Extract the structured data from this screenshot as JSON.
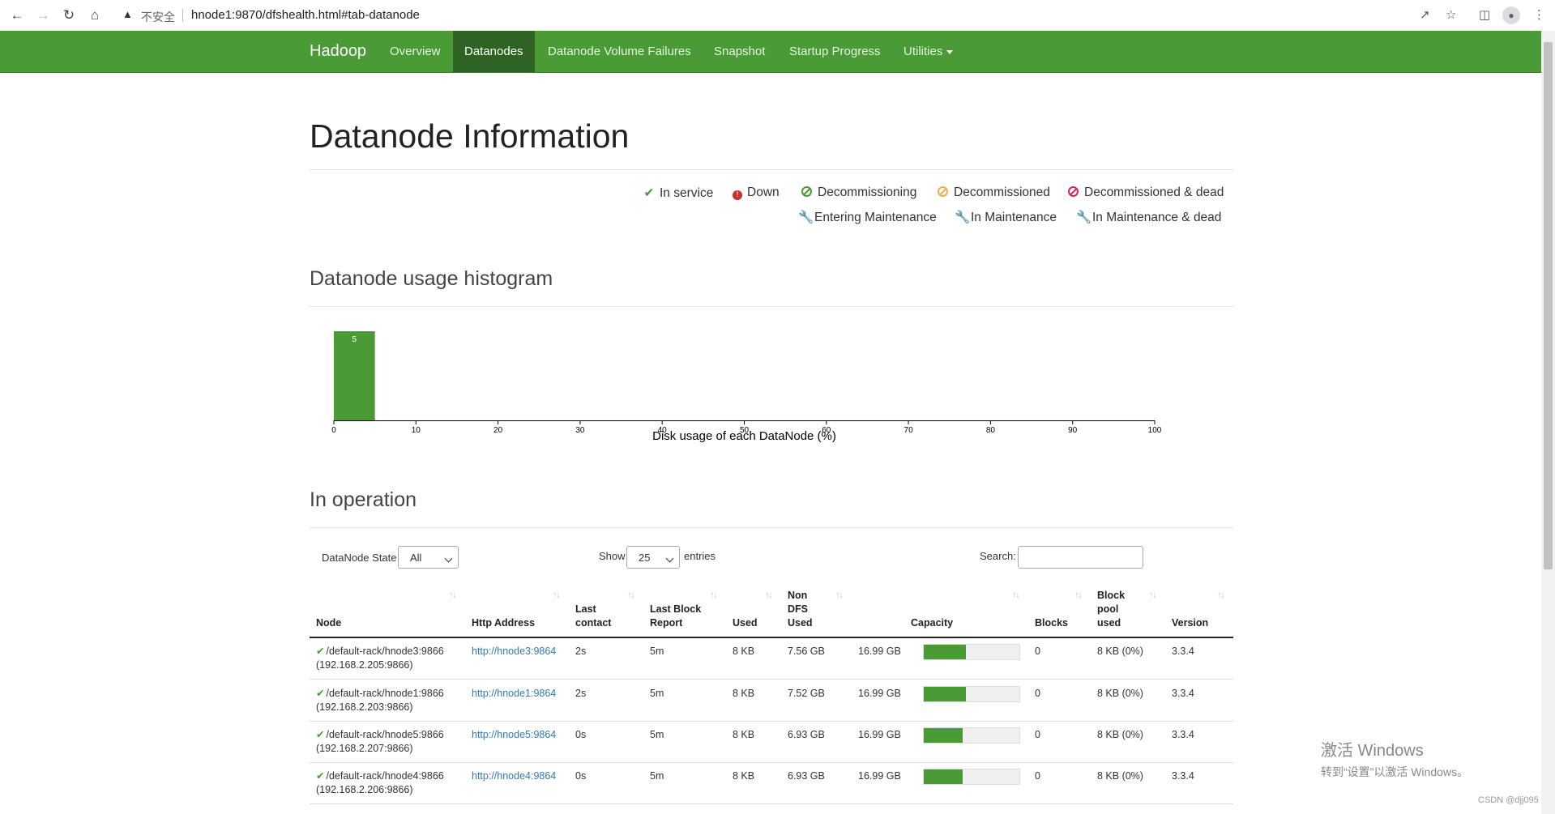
{
  "browser": {
    "security_label": "不安全",
    "url": "hnode1:9870/dfshealth.html#tab-datanode"
  },
  "navbar": {
    "brand": "Hadoop",
    "items": [
      "Overview",
      "Datanodes",
      "Datanode Volume Failures",
      "Snapshot",
      "Startup Progress",
      "Utilities"
    ],
    "active": "Datanodes"
  },
  "page": {
    "title": "Datanode Information",
    "legend": {
      "in_service": "In service",
      "down": "Down",
      "decommissioning": "Decommissioning",
      "decommissioned": "Decommissioned",
      "decommissioned_dead": "Decommissioned & dead",
      "entering_maintenance": "Entering Maintenance",
      "in_maintenance": "In Maintenance",
      "in_maintenance_dead": "In Maintenance & dead"
    },
    "colors": {
      "green": "#4a9a35",
      "red": "#c9302c",
      "orange": "#f0ad4e",
      "magenta": "#d9235a"
    }
  },
  "histogram": {
    "heading": "Datanode usage histogram",
    "chart_data": {
      "type": "bar",
      "xlabel": "Disk usage of each DataNode (%)",
      "xlim": [
        0,
        100
      ],
      "xticks": [
        "0",
        "10",
        "20",
        "30",
        "40",
        "50",
        "60",
        "70",
        "80",
        "90",
        "100"
      ],
      "bins": [
        {
          "x0": 0,
          "x1": 5,
          "count": 5,
          "label": "5"
        }
      ]
    }
  },
  "operation": {
    "heading": "In operation",
    "state_label": "DataNode State",
    "state_value": "All",
    "show_label": "Show",
    "show_value": "25",
    "entries_label": "entries",
    "search_label": "Search:",
    "columns": [
      "Node",
      "Http Address",
      "Last contact",
      "Last Block Report",
      "Used",
      "Non DFS Used",
      "Capacity",
      "Blocks",
      "Block pool used",
      "Version"
    ],
    "rows": [
      {
        "node": "/default-rack/hnode3:9866",
        "ip": "(192.168.2.205:9866)",
        "http": "http://hnode3:9864",
        "last_contact": "2s",
        "last_block_report": "5m",
        "used": "8 KB",
        "non_dfs": "7.56 GB",
        "capacity": "16.99 GB",
        "capacity_used_fraction": 0.44,
        "blocks": "0",
        "block_pool_used": "8 KB (0%)",
        "version": "3.3.4"
      },
      {
        "node": "/default-rack/hnode1:9866",
        "ip": "(192.168.2.203:9866)",
        "http": "http://hnode1:9864",
        "last_contact": "2s",
        "last_block_report": "5m",
        "used": "8 KB",
        "non_dfs": "7.52 GB",
        "capacity": "16.99 GB",
        "capacity_used_fraction": 0.44,
        "blocks": "0",
        "block_pool_used": "8 KB (0%)",
        "version": "3.3.4"
      },
      {
        "node": "/default-rack/hnode5:9866",
        "ip": "(192.168.2.207:9866)",
        "http": "http://hnode5:9864",
        "last_contact": "0s",
        "last_block_report": "5m",
        "used": "8 KB",
        "non_dfs": "6.93 GB",
        "capacity": "16.99 GB",
        "capacity_used_fraction": 0.41,
        "blocks": "0",
        "block_pool_used": "8 KB (0%)",
        "version": "3.3.4"
      },
      {
        "node": "/default-rack/hnode4:9866",
        "ip": "(192.168.2.206:9866)",
        "http": "http://hnode4:9864",
        "last_contact": "0s",
        "last_block_report": "5m",
        "used": "8 KB",
        "non_dfs": "6.93 GB",
        "capacity": "16.99 GB",
        "capacity_used_fraction": 0.41,
        "blocks": "0",
        "block_pool_used": "8 KB (0%)",
        "version": "3.3.4"
      }
    ]
  },
  "overlay": {
    "win_line1": "激活 Windows",
    "win_line2": "转到“设置”以激活 Windows。",
    "csdn": "CSDN @djj095"
  }
}
